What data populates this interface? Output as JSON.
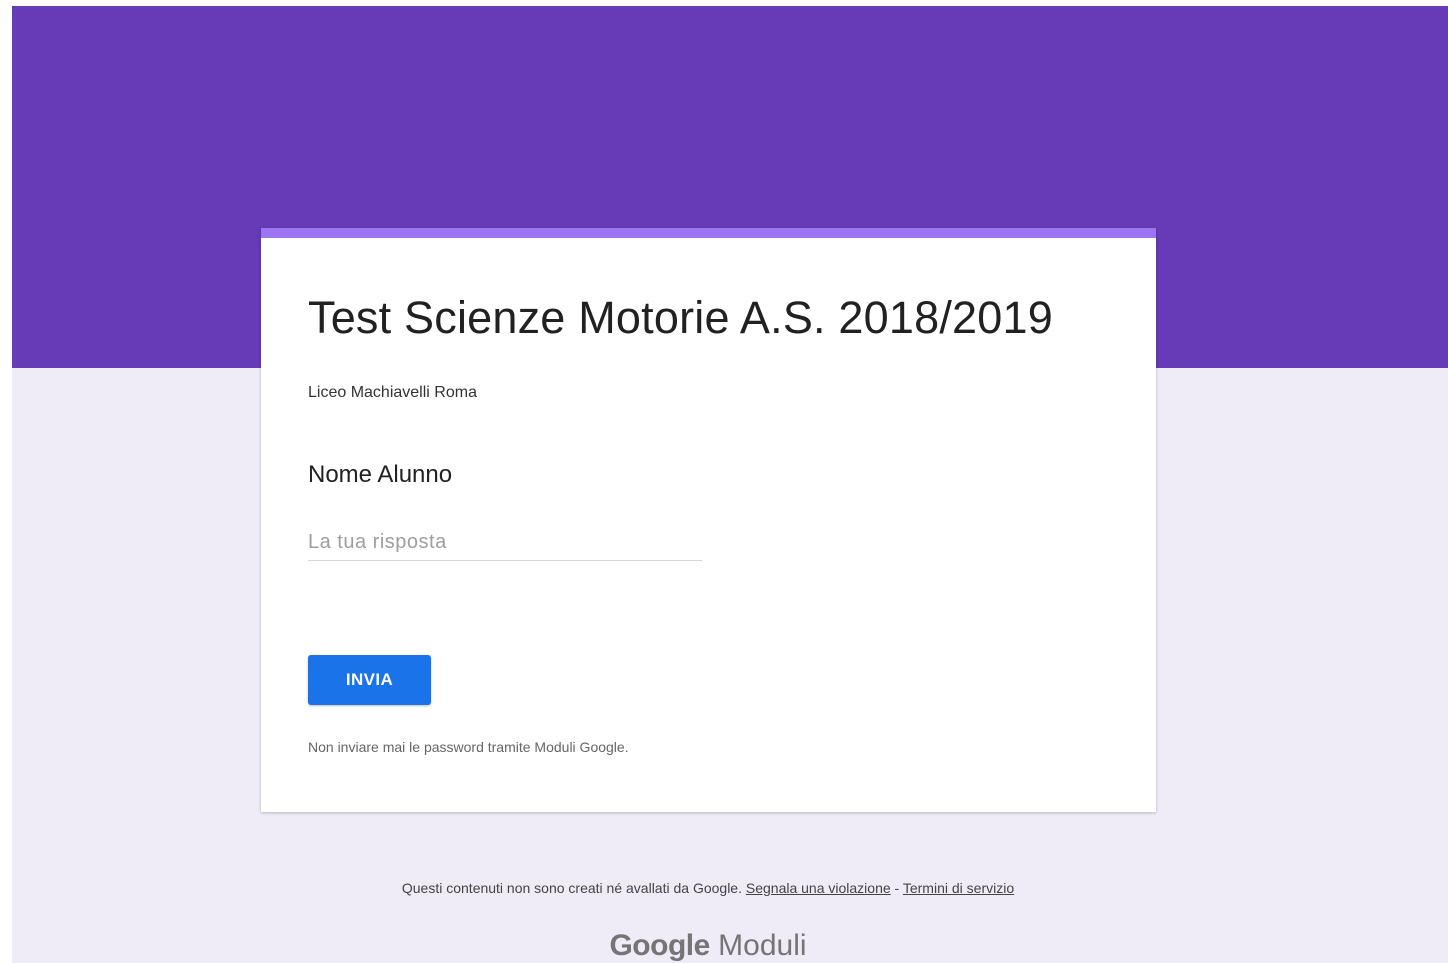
{
  "theme": {
    "header_color": "#673ab7",
    "card_accent": "#9e75f0",
    "page_background": "#efebf7",
    "button_color": "#1a73e8"
  },
  "form": {
    "title": "Test Scienze Motorie A.S. 2018/2019",
    "description": "Liceo Machiavelli Roma",
    "question": {
      "title": "Nome Alunno",
      "placeholder": "La tua risposta",
      "value": ""
    },
    "submit_label": "INVIA",
    "password_warning": "Non inviare mai le password tramite Moduli Google."
  },
  "footer": {
    "disclaimer": "Questi contenuti non sono creati né avallati da Google.",
    "report_link": "Segnala una violazione",
    "separator": " - ",
    "terms_link": "Termini di servizio"
  },
  "brand": {
    "google": "Google",
    "product": "Moduli"
  }
}
